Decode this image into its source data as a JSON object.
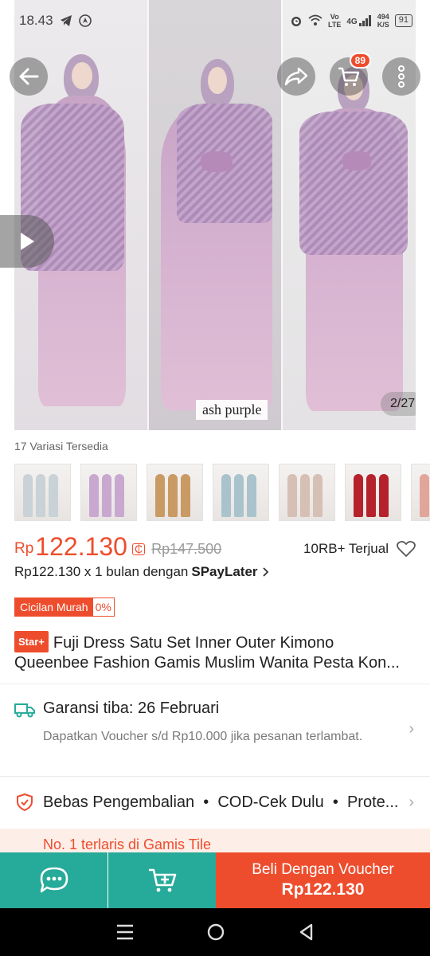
{
  "status_bar": {
    "time": "18.43",
    "volte_top": "Vo",
    "volte_bottom": "LTE",
    "network": "4G",
    "speed_value": "494",
    "speed_unit": "K/S",
    "battery": "91"
  },
  "hero": {
    "variant_label": "ash purple",
    "counter": "2/27",
    "cart_count": "89"
  },
  "variants": {
    "label": "17 Variasi Tersedia",
    "thumbs": [
      {
        "color": "#c9d2d6"
      },
      {
        "color": "#c9a8cf"
      },
      {
        "color": "#c99a63"
      },
      {
        "color": "#a9c3cc"
      },
      {
        "color": "#d6bfb4"
      },
      {
        "color": "#b5222b"
      },
      {
        "color": "#e1a59a"
      }
    ]
  },
  "price": {
    "currency": "Rp",
    "current": "122.130",
    "original": "Rp147.500",
    "sold": "10RB+ Terjual"
  },
  "spaylater": {
    "text": "Rp122.130 x 1 bulan dengan",
    "brand": "SPayLater"
  },
  "cicilan": {
    "label": "Cicilan Murah",
    "rate": "0%"
  },
  "product": {
    "badge": "Star+",
    "title_line1": "Fuji Dress Satu Set Inner Outer Kimono",
    "title_line2": "Queenbee Fashion Gamis Muslim Wanita Pesta Kon..."
  },
  "shipping": {
    "title": "Garansi tiba: 26 Februari",
    "subtitle": "Dapatkan Voucher s/d Rp10.000 jika pesanan terlambat."
  },
  "returns": {
    "text": "Bebas Pengembalian  •  COD-Cek Dulu  •  Prote..."
  },
  "promo": {
    "text": "No. 1 terlaris di Gamis Tile"
  },
  "bottom_bar": {
    "buy_label": "Beli Dengan Voucher",
    "buy_price": "Rp122.130"
  },
  "colors": {
    "accent": "#ee4d2d",
    "teal": "#26aa99"
  }
}
